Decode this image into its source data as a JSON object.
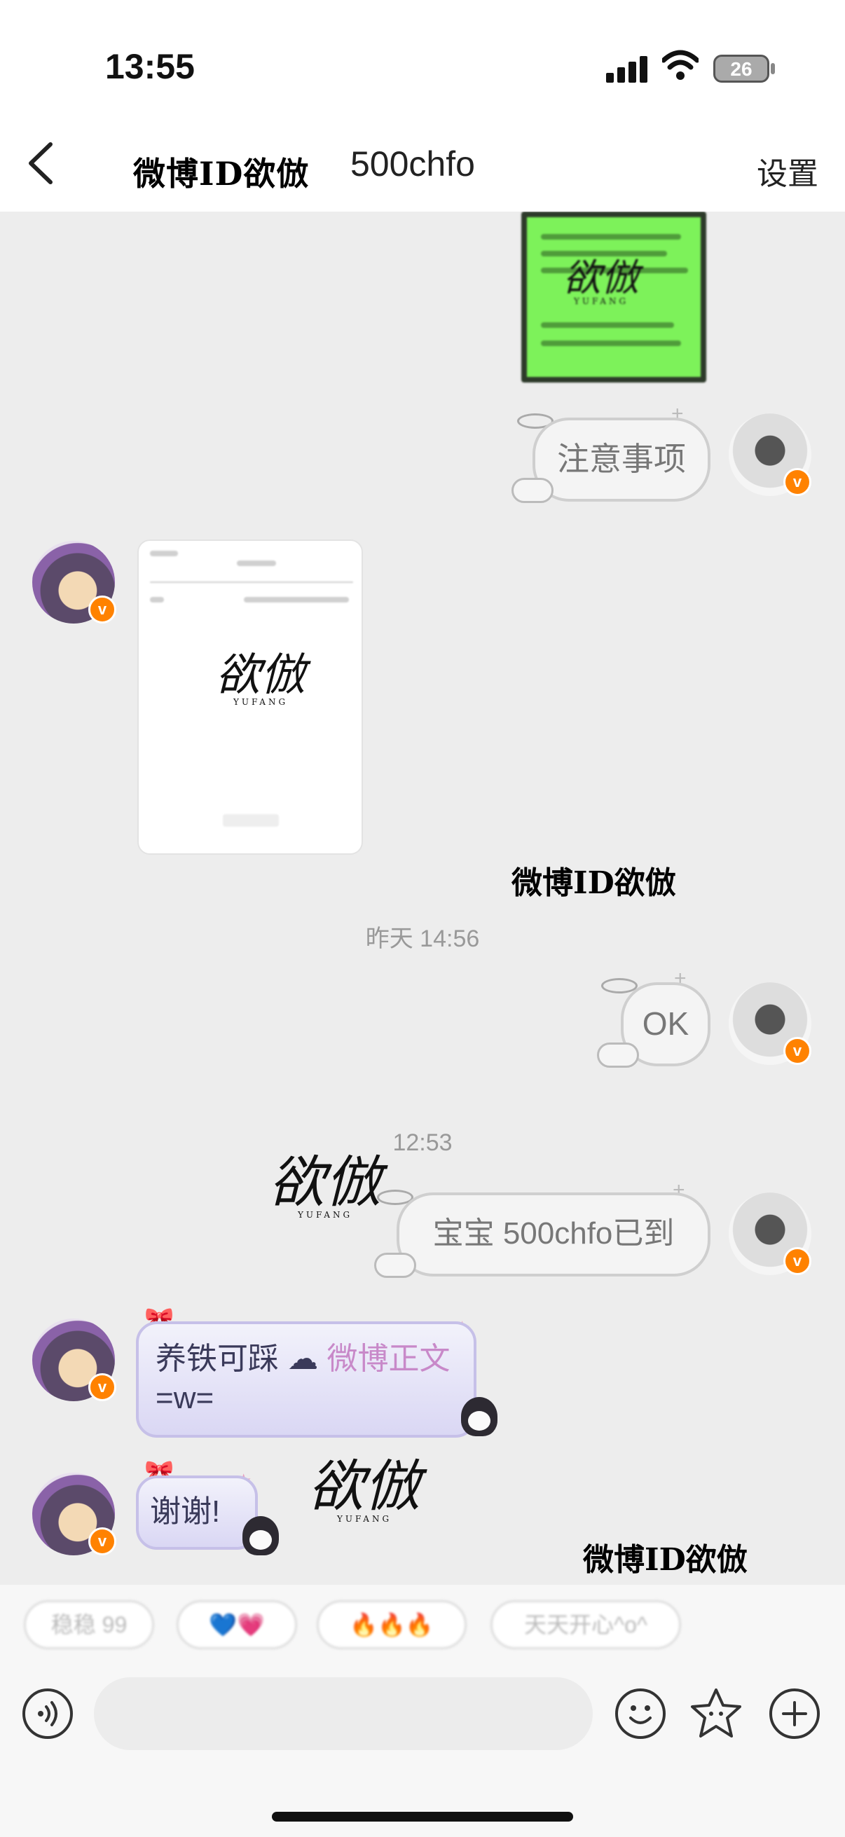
{
  "status_bar": {
    "time": "13:55",
    "battery": "26"
  },
  "nav": {
    "back_icon": "chevron-left-icon",
    "title_art": "微博ID欲倣",
    "title": "500chfo",
    "settings": "设置"
  },
  "watermark": {
    "text": "微博ID欲倣",
    "logo_main": "欲倣",
    "logo_sub": "YUFANG"
  },
  "messages": [
    {
      "id": "img-green",
      "side": "me",
      "type": "image"
    },
    {
      "id": "m1",
      "side": "me",
      "text": "注意事项"
    },
    {
      "id": "img-white",
      "side": "other",
      "type": "image"
    },
    {
      "id": "ts1",
      "type": "timestamp",
      "text": "昨天 14:56"
    },
    {
      "id": "m2",
      "side": "me",
      "text": "OK"
    },
    {
      "id": "ts2",
      "type": "timestamp",
      "text": "12:53"
    },
    {
      "id": "m3",
      "side": "me",
      "text": "宝宝 500chfo已到"
    },
    {
      "id": "m4",
      "side": "other",
      "text_a": "养铁可踩",
      "text_link": "微博正文",
      "text_b": "=w="
    },
    {
      "id": "m5",
      "side": "other",
      "text": "谢谢!"
    }
  ],
  "quick_replies": [
    "稳稳 99",
    "💙💗",
    "🔥🔥🔥",
    "天天开心^o^"
  ],
  "input_bar": {
    "voice_icon": "voice-icon",
    "emoji_icon": "emoji-icon",
    "sticker_icon": "sticker-icon",
    "plus_icon": "plus-icon"
  },
  "colors": {
    "accent": "#ff8200",
    "chat_bg": "#ededed",
    "link_pink": "#c889c9"
  }
}
